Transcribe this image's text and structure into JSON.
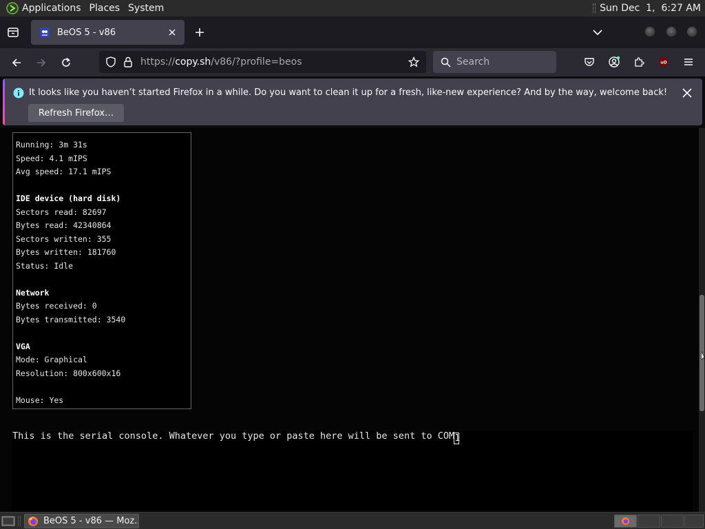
{
  "top_panel": {
    "menus": [
      "Applications",
      "Places",
      "System"
    ],
    "clock": "Sun Dec  1,  6:27 AM"
  },
  "browser": {
    "tab": {
      "title": "BeOS 5 - v86"
    },
    "url": {
      "prefix": "https://",
      "host": "copy.sh",
      "path": "/v86/?profile=beos"
    },
    "search_placeholder": "Search"
  },
  "notification": {
    "message": "It looks like you haven’t started Firefox in a while. Do you want to clean it up for a fresh, like-new experience? And by the way, welcome back!",
    "button_label": "Refresh Firefox…"
  },
  "stats": {
    "running": "Running: 3m 31s",
    "speed": "Speed: 4.1 mIPS",
    "avg_speed": "Avg speed: 17.1 mIPS",
    "ide_heading": "IDE device (hard disk)",
    "sectors_read": "Sectors read: 82697",
    "bytes_read": "Bytes read: 42340864",
    "sectors_written": "Sectors written: 355",
    "bytes_written": "Bytes written: 181760",
    "status": "Status: Idle",
    "network_heading": "Network",
    "bytes_received": "Bytes received: 0",
    "bytes_transmitted": "Bytes transmitted: 3540",
    "vga_heading": "VGA",
    "mode": "Mode: Graphical",
    "resolution": "Resolution: 800x600x16",
    "mouse": "Mouse: Yes"
  },
  "serial_console": {
    "text": "This is the serial console. Whatever you type or paste here will be sent to COM",
    "cursor_char": "1"
  },
  "taskbar": {
    "task_label": "BeOS 5 - v86 — Moz..."
  },
  "colors": {
    "panel": "#2b2b2b",
    "tabstrip": "#1c1b22",
    "toolbar": "#2b2a33",
    "notification": "#42414d",
    "accent_info": "#0090ed"
  }
}
